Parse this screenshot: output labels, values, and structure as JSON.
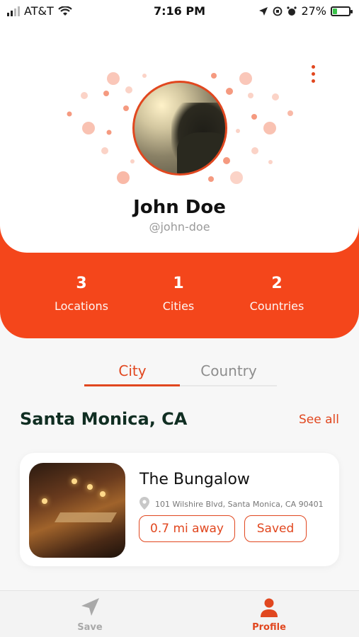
{
  "status_bar": {
    "carrier": "AT&T",
    "time": "7:16 PM",
    "battery": "27%",
    "battery_level": 0.27,
    "icons": [
      "signal-icon",
      "wifi-icon",
      "location-arrow-icon",
      "orientation-lock-icon",
      "alarm-icon",
      "battery-icon"
    ]
  },
  "profile": {
    "name": "John Doe",
    "handle": "@john-doe",
    "menu_icon": "kebab-menu-icon"
  },
  "stats": [
    {
      "value": "3",
      "label": "Locations"
    },
    {
      "value": "1",
      "label": "Cities"
    },
    {
      "value": "2",
      "label": "Countries"
    }
  ],
  "tabs": [
    {
      "label": "City",
      "active": true
    },
    {
      "label": "Country",
      "active": false
    }
  ],
  "section": {
    "title": "Santa Monica, CA",
    "see_all": "See all"
  },
  "place": {
    "name": "The Bungalow",
    "address": "101 Wilshire Blvd, Santa Monica, CA 90401",
    "distance": "0.7 mi away",
    "status": "Saved"
  },
  "bottom_nav": [
    {
      "label": "Save",
      "icon": "navigation-arrow-icon",
      "active": false
    },
    {
      "label": "Profile",
      "icon": "person-icon",
      "active": true
    }
  ],
  "colors": {
    "accent": "#e1471f",
    "stats_bg": "#f4461b",
    "inactive": "#8d8d8d"
  }
}
